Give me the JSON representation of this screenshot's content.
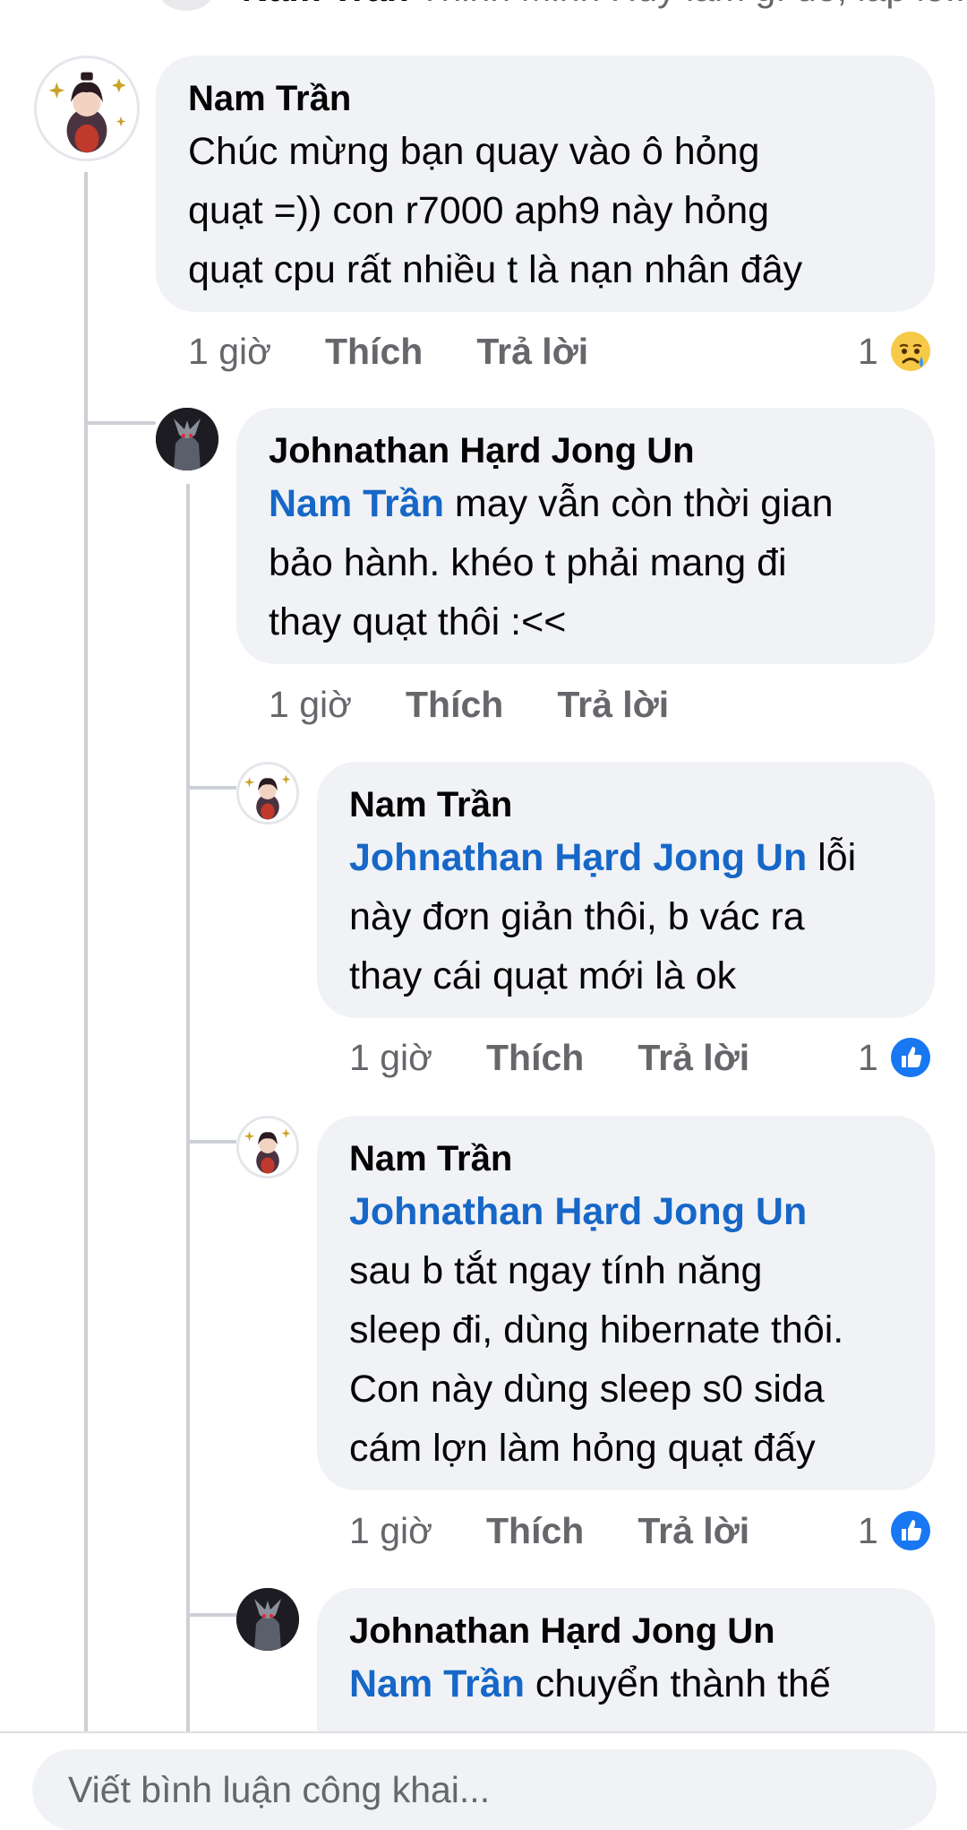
{
  "top_partial": {
    "author": "Nam Trần",
    "text": "Thinh Minh Huy làm gì đó, lắp lỗ..."
  },
  "comments": [
    {
      "author": "Nam Trần",
      "text_lines": [
        "Chúc mừng bạn quay vào ô hỏng",
        "quạt =)) con r7000 aph9 này hỏng",
        "quạt cpu rất nhiều t là nạn nhân đây"
      ],
      "time": "1 giờ",
      "like": "Thích",
      "reply": "Trả lời",
      "reaction_count": "1",
      "reaction_icon": "sad-reaction-icon"
    },
    {
      "author": "Johnathan Hạrd Jong Un",
      "mention": "Nam Trần",
      "first_line_rest": " may vẫn còn thời gian",
      "text_lines": [
        "bảo hành. khéo t phải mang đi",
        "thay quạt thôi :<<"
      ],
      "time": "1 giờ",
      "like": "Thích",
      "reply": "Trả lời"
    },
    {
      "author": "Nam Trần",
      "mention": "Johnathan Hạrd Jong Un",
      "first_line_rest": " lỗi",
      "text_lines": [
        "này đơn giản thôi, b vác ra",
        "thay cái quạt mới là ok"
      ],
      "time": "1 giờ",
      "like": "Thích",
      "reply": "Trả lời",
      "reaction_count": "1",
      "reaction_icon": "like-reaction-icon"
    },
    {
      "author": "Nam Trần",
      "mention": "Johnathan Hạrd Jong Un",
      "text_lines": [
        "sau b tắt ngay tính năng",
        "sleep đi, dùng hibernate thôi.",
        "Con này dùng sleep s0 sida",
        "cám lợn làm hỏng quạt đấy"
      ],
      "time": "1 giờ",
      "like": "Thích",
      "reply": "Trả lời",
      "reaction_count": "1",
      "reaction_icon": "like-reaction-icon"
    },
    {
      "author": "Johnathan Hạrd Jong Un",
      "mention": "Nam Trần",
      "first_line_rest": " chuyển thành thế"
    }
  ],
  "composer": {
    "placeholder": "Viết bình luận công khai..."
  },
  "colors": {
    "mention": "#1667c7",
    "bubble": "#f0f2f5",
    "meta": "#65676b",
    "like_blue": "#1877f2"
  }
}
